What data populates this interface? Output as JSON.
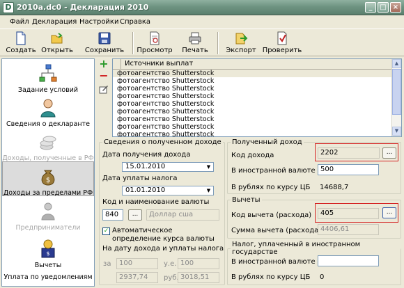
{
  "window": {
    "title": "2010a.dc0 - Декларация 2010",
    "app_icon_glyph": "D"
  },
  "menu": [
    "Файл",
    "Декларация",
    "Настройки",
    "Справка"
  ],
  "toolbar": {
    "create": "Создать",
    "open": "Открыть",
    "save": "Сохранить",
    "preview": "Просмотр",
    "print": "Печать",
    "export": "Экспорт",
    "check": "Проверить"
  },
  "nav": [
    {
      "label": "Задание условий",
      "icon": "network-icon"
    },
    {
      "label": "Сведения о декларанте",
      "icon": "person-icon"
    },
    {
      "label": "Доходы, полученные в РФ",
      "icon": "coins-icon"
    },
    {
      "label": "Доходы за пределами РФ",
      "icon": "moneybag-icon"
    },
    {
      "label": "Предприниматели",
      "icon": "businessman-icon"
    },
    {
      "label": "Вычеты",
      "icon": "deductions-icon"
    },
    {
      "label": "Уплата по уведомлениям",
      "icon": "notice-icon"
    }
  ],
  "sources": {
    "header": "Источники выплат",
    "rows": [
      "фотоагентство Shutterstock",
      "фотоагентство Shutterstock",
      "фотоагентство Shutterstock",
      "фотоагентство Shutterstock",
      "фотоагентство Shutterstock",
      "фотоагентство Shutterstock",
      "фотоагентство Shutterstock",
      "фотоагентство Shutterstock",
      "фотоагентство Shutterstock"
    ]
  },
  "income_info": {
    "legend": "Сведения о полученном доходе",
    "date_received_label": "Дата получения дохода",
    "date_received": "15.01.2010",
    "date_paid_label": "Дата уплаты налога",
    "date_paid": "01.01.2010",
    "currency_label": "Код и наименование валюты",
    "currency_code": "840",
    "currency_name": "Доллар сша",
    "auto_rate_label": "Автоматическое определение курса валюты",
    "auto_rate_checked": "✓",
    "on_date_label": "На дату дохода и уплаты налога",
    "qty_label_1": "за",
    "qty_value_1": "100",
    "unit_label": "у.е.",
    "unit_value": "100",
    "amount_value_1": "2937,74",
    "rub_label": "руб.",
    "amount_value_2": "3018,51"
  },
  "received_income": {
    "legend": "Полученный доход",
    "code_label": "Код дохода",
    "code": "2202",
    "foreign_label": "В иностранной валюте",
    "foreign_value": "500",
    "rubles_label": "В рублях по курсу ЦБ",
    "rubles_value": "14688,7"
  },
  "deductions": {
    "legend": "Вычеты",
    "code_label": "Код вычета (расхода)",
    "code": "405",
    "sum_label": "Сумма вычета (расхода)",
    "sum_value": "4406,61"
  },
  "foreign_tax": {
    "legend": "Налог, уплаченный в иностранном государстве",
    "foreign_label": "В иностранной валюте",
    "foreign_value": "",
    "rubles_label": "В рублях по курсу ЦБ",
    "rubles_value": "0"
  },
  "common": {
    "ellipsis": "..."
  },
  "colors": {
    "highlight_box": "#d42020",
    "add_icon": "#2a9a2a",
    "remove_icon": "#d02020"
  }
}
